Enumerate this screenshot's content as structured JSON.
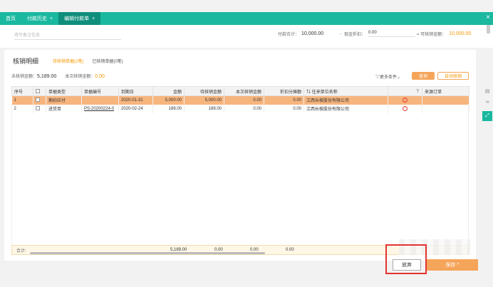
{
  "tabs": [
    {
      "label": "首页",
      "closable": false,
      "active": false
    },
    {
      "label": "付款历史",
      "closable": true,
      "active": false
    },
    {
      "label": "编辑付款单",
      "closable": true,
      "active": true
    }
  ],
  "filter": {
    "remark_placeholder": "填写备注信息",
    "pay_total_label": "付款合计：",
    "pay_total_value": "10,000.00",
    "discount_label": "现金折扣：",
    "discount_value": "0.00",
    "available_label": "= 可核销金额：",
    "available_value": "10,000.00"
  },
  "section": {
    "title": "核销明细",
    "subtabs": [
      "待核销单据(2笔)",
      "已核销单据(0笔)"
    ]
  },
  "amounts": {
    "unverified_label": "未核销金额：",
    "unverified_value": "5,189.00",
    "current_label": "本次核销金额：",
    "current_value": "0.00"
  },
  "toolbar": {
    "more_label": "更多条件",
    "query_label": "查询",
    "auto_label": "自动核销"
  },
  "table": {
    "headers": [
      "序号",
      "",
      "单据类型",
      "单据编号",
      "到期日",
      "金额",
      "待核销金额",
      "本次核销金额",
      "折扣分摊额",
      "往来单位名称",
      "",
      "来源订单"
    ],
    "rows": [
      {
        "no": "1",
        "type": "期初应付",
        "code": "",
        "due": "2020-01-31",
        "amount": "5,000.00",
        "pending": "5,000.00",
        "current": "0.00",
        "discount": "0.00",
        "partner": "江西长棱股份有限公司",
        "selected": true
      },
      {
        "no": "2",
        "type": "进货单",
        "code": "PS-20200224-0",
        "due": "2020-02-24",
        "amount": "189.00",
        "pending": "189.00",
        "current": "0.00",
        "discount": "0.00",
        "partner": "江西长棱股份有限公司",
        "selected": false
      }
    ]
  },
  "summary": {
    "label": "合计:",
    "amount": "5,189.00",
    "pending": "0.00",
    "current": "0.00",
    "discount": "0.00"
  },
  "footer": {
    "abandon_label": "放弃",
    "save_label": "保存 ^"
  },
  "colors": {
    "accent": "#19b89f",
    "orange": "#f5a55a",
    "highlight": "#e3342f"
  }
}
